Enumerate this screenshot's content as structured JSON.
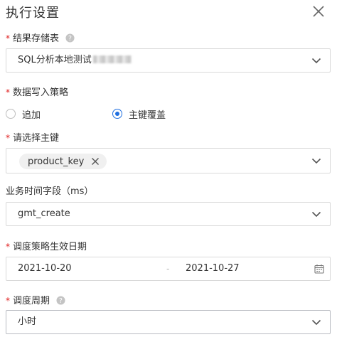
{
  "dialog": {
    "title": "执行设置"
  },
  "fields": {
    "result_table": {
      "label": "结果存储表",
      "required_mark": "*",
      "value": "SQL分析本地测试"
    },
    "write_strategy": {
      "label": "数据写入策略",
      "required_mark": "*",
      "options": [
        {
          "label": "追加",
          "selected": false
        },
        {
          "label": "主键覆盖",
          "selected": true
        }
      ]
    },
    "primary_key": {
      "label": "请选择主键",
      "required_mark": "*",
      "tags": [
        "product_key"
      ]
    },
    "business_time": {
      "label": "业务时间字段（ms）",
      "value": "gmt_create"
    },
    "effective_dates": {
      "label": "调度策略生效日期",
      "required_mark": "*",
      "start": "2021-10-20",
      "separator": "-",
      "end": "2021-10-27"
    },
    "schedule_period": {
      "label": "调度周期",
      "required_mark": "*",
      "value": "小时"
    }
  },
  "colors": {
    "required": "#e02020",
    "radio_checked": "#1f6fe0",
    "border": "#d9d9d9"
  },
  "icons": {
    "close": "close-icon",
    "help": "question-circle-icon",
    "chevron": "chevron-down-icon",
    "calendar": "calendar-icon",
    "tag_remove": "x-icon"
  }
}
